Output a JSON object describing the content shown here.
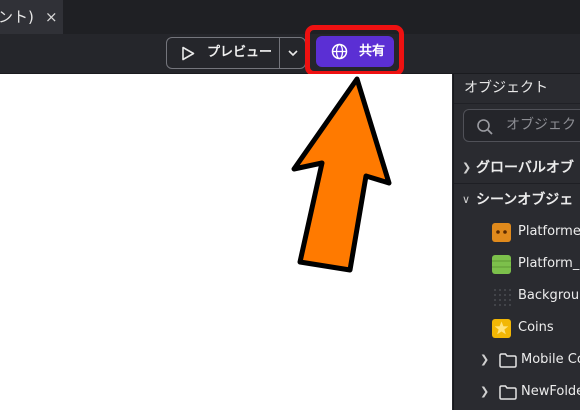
{
  "tab": {
    "title": "ント)",
    "close": "×"
  },
  "toolbar": {
    "preview_label": "プレビュー",
    "share_label": "共有"
  },
  "panel": {
    "title": "オブジェクト",
    "search_placeholder": "オブジェク",
    "sections": {
      "global": "グローバルオブ",
      "scene": "シーンオブジェ"
    },
    "objects": [
      {
        "name": "Platforme",
        "icon": "platformer-orange-icon"
      },
      {
        "name": "Platform_",
        "icon": "grass-tile-icon"
      },
      {
        "name": "Backgrou",
        "icon": "background-dots-icon"
      },
      {
        "name": "Coins",
        "icon": "coin-star-icon"
      }
    ],
    "folders": [
      {
        "name": "Mobile Co"
      },
      {
        "name": "NewFolde"
      }
    ]
  },
  "colors": {
    "share_bg": "#5b2fd4",
    "highlight": "#ee1111",
    "arrow": "#ff7a00"
  }
}
